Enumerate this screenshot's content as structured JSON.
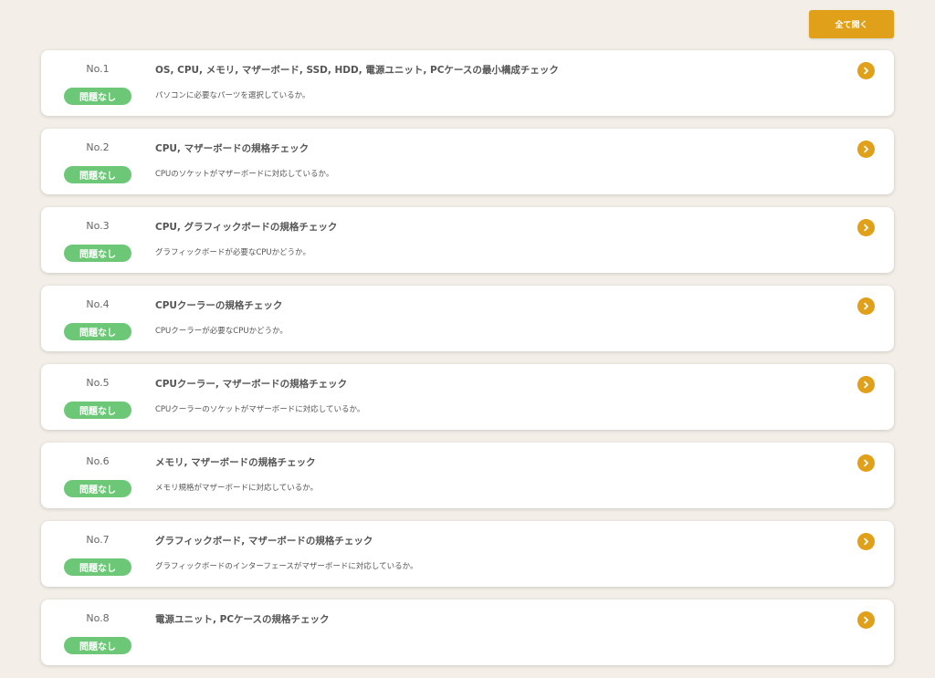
{
  "toolbar": {
    "open_all_label": "全て開く"
  },
  "checks": [
    {
      "no": "No.1",
      "status": "問題なし",
      "title": "OS, CPU, メモリ, マザーボード, SSD, HDD, 電源ユニット, PCケースの最小構成チェック",
      "desc": "パソコンに必要なパーツを選択しているか。"
    },
    {
      "no": "No.2",
      "status": "問題なし",
      "title": "CPU, マザーボードの規格チェック",
      "desc": "CPUのソケットがマザーボードに対応しているか。"
    },
    {
      "no": "No.3",
      "status": "問題なし",
      "title": "CPU, グラフィックボードの規格チェック",
      "desc": "グラフィックボードが必要なCPUかどうか。"
    },
    {
      "no": "No.4",
      "status": "問題なし",
      "title": "CPUクーラーの規格チェック",
      "desc": "CPUクーラーが必要なCPUかどうか。"
    },
    {
      "no": "No.5",
      "status": "問題なし",
      "title": "CPUクーラー, マザーボードの規格チェック",
      "desc": "CPUクーラーのソケットがマザーボードに対応しているか。"
    },
    {
      "no": "No.6",
      "status": "問題なし",
      "title": "メモリ, マザーボードの規格チェック",
      "desc": "メモリ規格がマザーボードに対応しているか。"
    },
    {
      "no": "No.7",
      "status": "問題なし",
      "title": "グラフィックボード, マザーボードの規格チェック",
      "desc": "グラフィックボードのインターフェースがマザーボードに対応しているか。"
    },
    {
      "no": "No.8",
      "status": "問題なし",
      "title": "電源ユニット, PCケースの規格チェック",
      "desc": ""
    }
  ],
  "icons": {
    "expand": "chevron-right-circle-icon"
  },
  "colors": {
    "accent": "#e0a01a",
    "ok": "#6cc877",
    "background": "#f3efe8"
  }
}
